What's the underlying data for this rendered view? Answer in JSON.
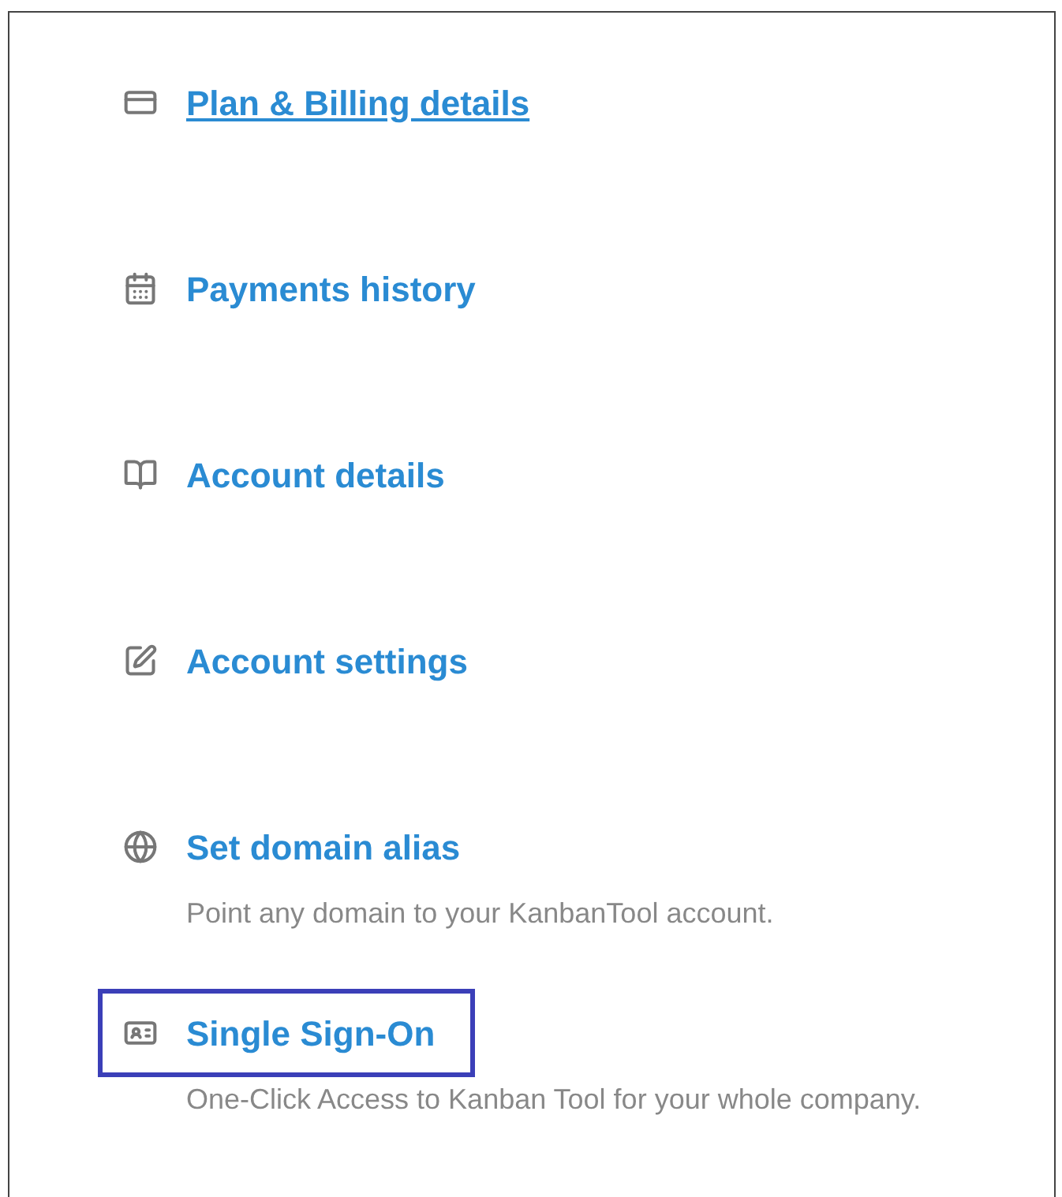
{
  "items": [
    {
      "kind": "card",
      "title": "Plan & Billing details",
      "underlined": true,
      "highlighted": false
    },
    {
      "kind": "calendar",
      "title": "Payments history",
      "underlined": false,
      "highlighted": false
    },
    {
      "kind": "book",
      "title": "Account details",
      "underlined": false,
      "highlighted": false
    },
    {
      "kind": "edit",
      "title": "Account settings",
      "underlined": false,
      "highlighted": false
    },
    {
      "kind": "globe",
      "title": "Set domain alias",
      "description": "Point any domain to your KanbanTool account.",
      "underlined": false,
      "highlighted": false
    },
    {
      "kind": "id",
      "title": "Single Sign-On",
      "description": "One-Click Access to Kanban Tool for your whole company.",
      "underlined": false,
      "highlighted": true
    }
  ]
}
